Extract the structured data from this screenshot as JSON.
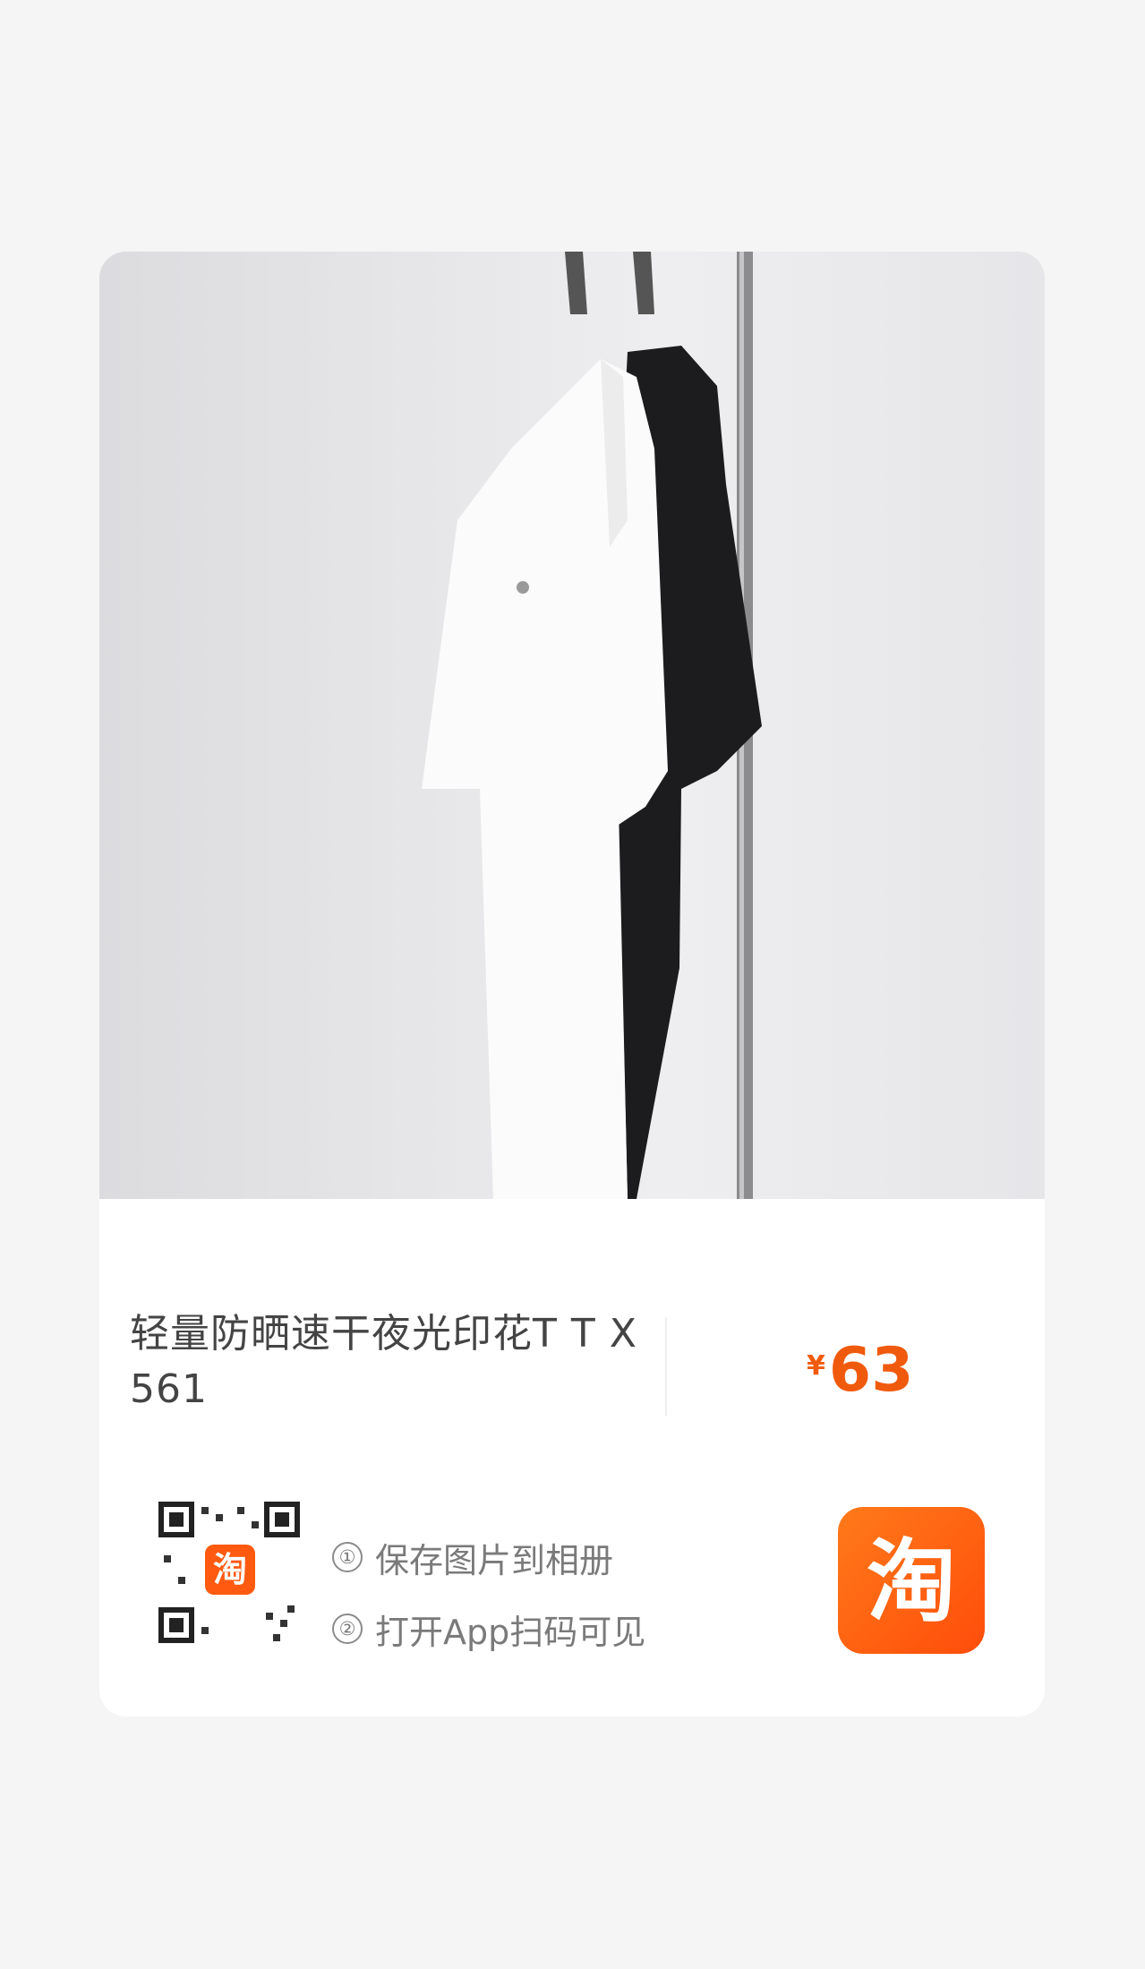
{
  "product": {
    "title": "轻量防晒速干夜光印花T T X561",
    "price_symbol": "¥",
    "price_value": "63"
  },
  "share": {
    "step1_number": "①",
    "step1_text": "保存图片到相册",
    "step2_number": "②",
    "step2_text": "打开App扫码可见"
  },
  "icons": {
    "qr": "qr-code-icon",
    "app": "taobao-app-icon",
    "qr_badge": "taobao-qr-badge-icon"
  },
  "colors": {
    "price": "#f05a0d",
    "brand": "#ff5a0f",
    "card_bg": "#ffffff",
    "page_bg": "#f5f5f5"
  }
}
